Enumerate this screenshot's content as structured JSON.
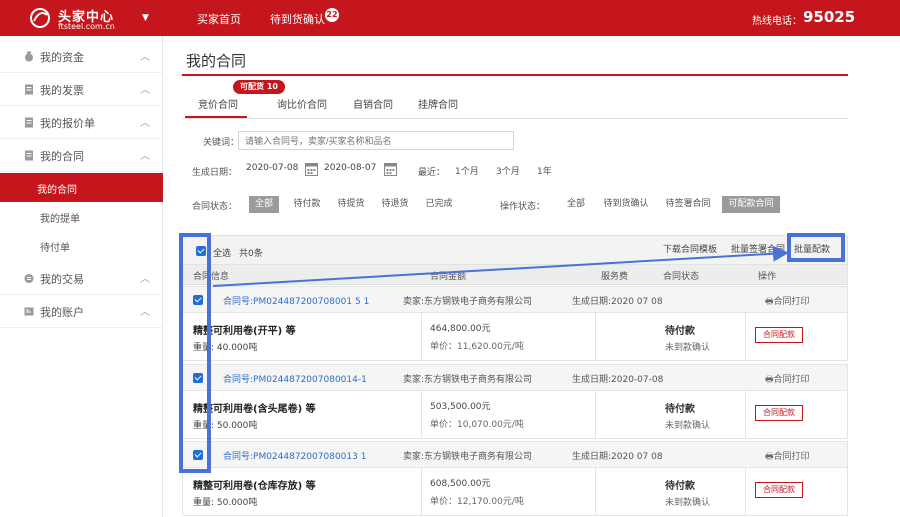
{
  "header": {
    "logo_title": "头家中心",
    "logo_sub": "ftsteel.com.cn",
    "nav_home": "买家首页",
    "nav_confirm": "待到货确认",
    "nav_confirm_badge": "22",
    "hotline_label": "热线电话：",
    "hotline_number": "95025"
  },
  "sidebar": {
    "items": [
      {
        "label": "我的资金"
      },
      {
        "label": "我的发票"
      },
      {
        "label": "我的报价单"
      },
      {
        "label": "我的合同"
      }
    ],
    "subitems": [
      {
        "label": "我的合同"
      },
      {
        "label": "我的提单"
      },
      {
        "label": "待付单"
      }
    ],
    "items_after": [
      {
        "label": "我的交易"
      },
      {
        "label": "我的账户"
      }
    ]
  },
  "page": {
    "title": "我的合同",
    "tabs": [
      "竞价合同",
      "询比价合同",
      "自销合同",
      "挂牌合同"
    ],
    "tab_badge": "可配货 10"
  },
  "filters": {
    "keyword_label": "关键词：",
    "keyword_placeholder": "请输入合同号，卖家/买家名称和品名",
    "date_label": "生成日期：",
    "date_from": "2020-07-08",
    "date_to": "2020-08-07",
    "recent_label": "最近：",
    "ranges": [
      "1个月",
      "3个月",
      "1年"
    ],
    "contract_status_label": "合同状态：",
    "contract_statuses": [
      "全部",
      "待付款",
      "待提货",
      "待退货",
      "已完成"
    ],
    "op_status_label": "操作状态：",
    "op_statuses": [
      "全部",
      "待到货确认",
      "待签署合同",
      "可配款合同"
    ]
  },
  "table": {
    "select_all": "全选",
    "count_text": "共0条",
    "download_template": "下载合同模板",
    "batch_sign": "批量签署合同",
    "batch_pay": "批量配款",
    "columns": [
      "合同信息",
      "合同金额",
      "服务费",
      "合同状态",
      "操作"
    ],
    "rows": [
      {
        "contract_no": "合同号:PM024487200708001 5 1",
        "seller": "卖家:东方钢铁电子商务有限公司",
        "date": "生成日期:2020 07 08",
        "print": "合同打印",
        "product": "精整可利用卷(开平) 等",
        "qty": "重量: 40.000吨",
        "amount": "464,800.00元",
        "price": "单价：11,620.00元/吨",
        "status": "待付款",
        "sub_status": "未到款确认",
        "action": "合同配款"
      },
      {
        "contract_no": "合同号:PM0244872007080014-1",
        "seller": "卖家:东方钢铁电子商务有限公司",
        "date": "生成日期:2020-07-08",
        "print": "合同打印",
        "product": "精整可利用卷(含头尾卷) 等",
        "qty": "重量: 50.000吨",
        "amount": "503,500.00元",
        "price": "单价：10,070.00元/吨",
        "status": "待付款",
        "sub_status": "未到款确认",
        "action": "合同配款"
      },
      {
        "contract_no": "合同号:PM0244872007080013 1",
        "seller": "卖家:东方钢铁电子商务有限公司",
        "date": "生成日期:2020 07 08",
        "print": "合同打印",
        "product": "精整可利用卷(仓库存放) 等",
        "qty": "重量: 50.000吨",
        "amount": "608,500.00元",
        "price": "单价：12,170.00元/吨",
        "status": "待付款",
        "sub_status": "未到款确认",
        "action": "合同配款"
      }
    ]
  },
  "colors": {
    "brand": "#c4161c",
    "annotation": "#4a72d6",
    "link": "#2d6ec9"
  }
}
